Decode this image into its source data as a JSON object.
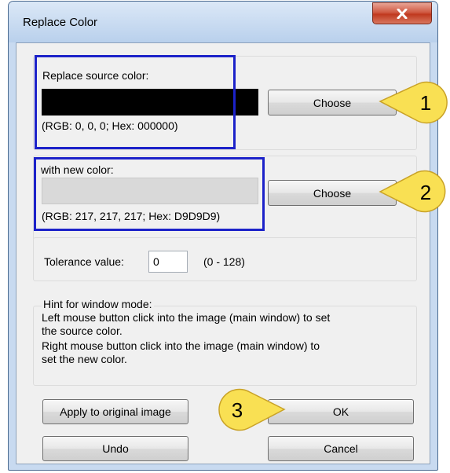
{
  "window": {
    "title": "Replace Color",
    "close_glyph": "x"
  },
  "source": {
    "label": "Replace source color:",
    "swatch_color": "#000000",
    "info": "(RGB: 0, 0, 0; Hex: 000000)",
    "choose_label": "Choose"
  },
  "target": {
    "label": "with new color:",
    "swatch_color": "#D9D9D9",
    "info": "(RGB: 217, 217, 217; Hex: D9D9D9)",
    "choose_label": "Choose"
  },
  "tolerance": {
    "label": "Tolerance value:",
    "value": "0",
    "range": "(0 - 128)"
  },
  "hint": {
    "title": "Hint for window mode:",
    "line1": "Left mouse button click into the image (main window) to set",
    "line2": "the source color.",
    "line3": "Right mouse button click into the image (main window) to",
    "line4": "set the new color."
  },
  "buttons": {
    "apply": "Apply to original image",
    "ok": "OK",
    "undo": "Undo",
    "cancel": "Cancel"
  },
  "callouts": {
    "one": "1",
    "two": "2",
    "three": "3",
    "color": "#F9E053"
  },
  "highlight_color": "#1C22C9"
}
